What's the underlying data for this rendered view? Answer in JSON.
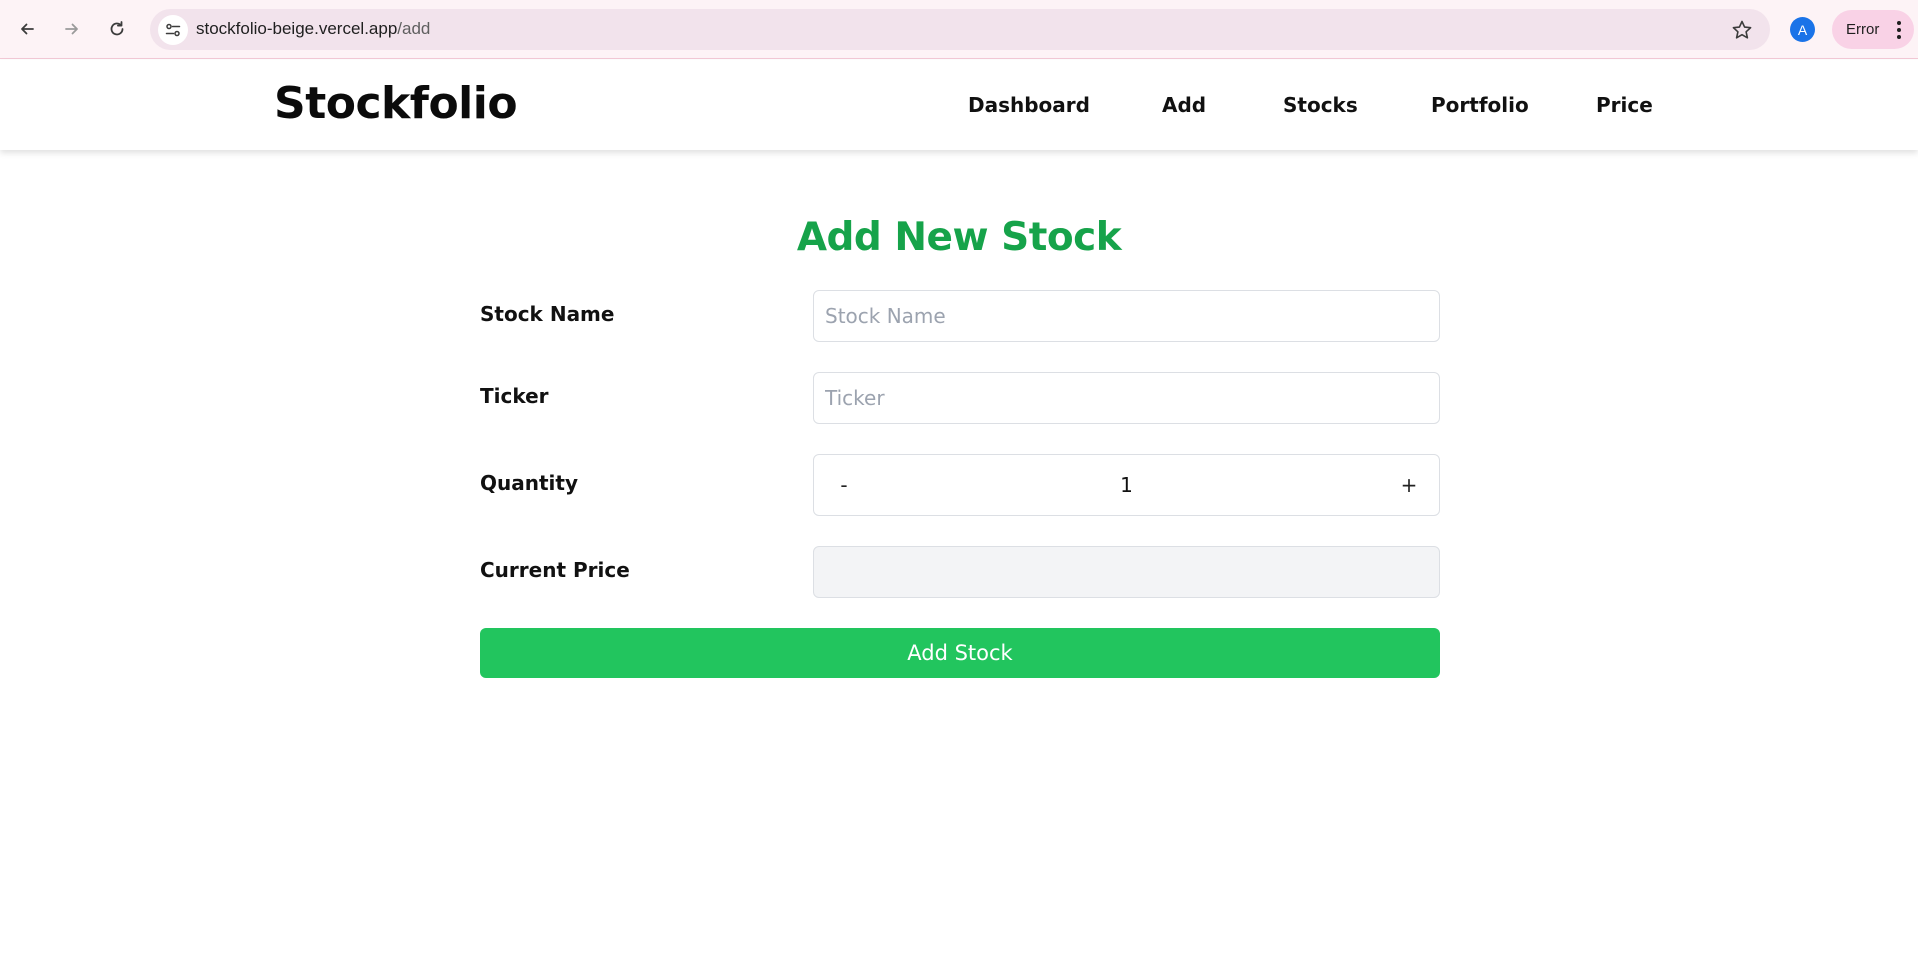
{
  "browser": {
    "url_host": "stockfolio-beige.vercel.app",
    "url_path": "/add",
    "profile_initial": "A",
    "status_chip": "Error",
    "icons": [
      "back-arrow-icon",
      "forward-arrow-icon",
      "reload-icon",
      "site-settings-icon",
      "bookmark-star-icon",
      "more-vert-icon"
    ]
  },
  "header": {
    "brand": "Stockfolio",
    "nav": [
      "Dashboard",
      "Add",
      "Stocks",
      "Portfolio",
      "Price"
    ]
  },
  "form": {
    "title": "Add New Stock",
    "stock_name": {
      "label": "Stock Name",
      "placeholder": "Stock Name",
      "value": ""
    },
    "ticker": {
      "label": "Ticker",
      "placeholder": "Ticker",
      "value": ""
    },
    "quantity": {
      "label": "Quantity",
      "decrement": "-",
      "increment": "+",
      "value": "1"
    },
    "current_price": {
      "label": "Current Price",
      "value": ""
    },
    "submit_label": "Add Stock"
  },
  "colors": {
    "accent_green": "#22c55e",
    "title_green": "#16a34a",
    "chrome_bg": "#fdf3f6",
    "error_chip_bg": "#f9d2e6"
  }
}
